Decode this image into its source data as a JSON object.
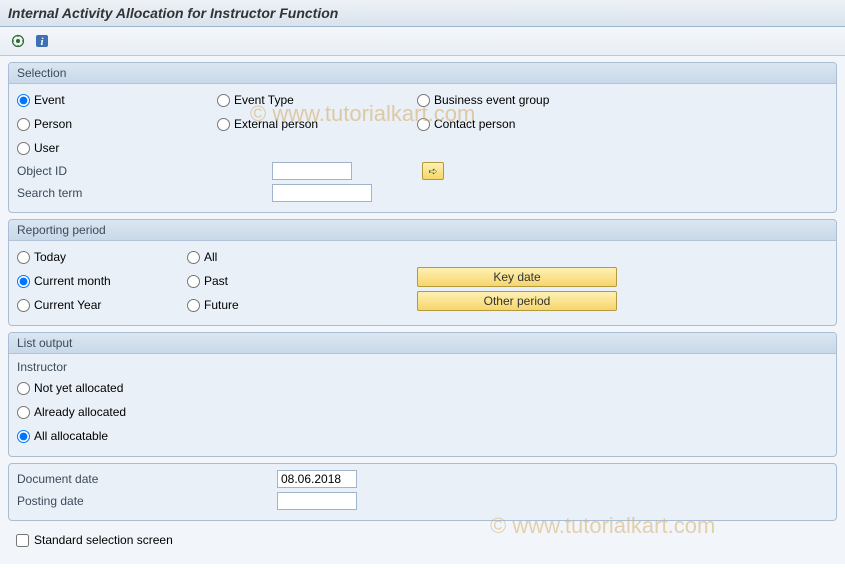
{
  "title": "Internal Activity Allocation for Instructor Function",
  "watermark": "© www.tutorialkart.com",
  "toolbar": {
    "execute_icon": "execute",
    "info_icon": "info"
  },
  "selection": {
    "header": "Selection",
    "options": {
      "event": "Event",
      "event_type": "Event Type",
      "business_event_group": "Business event group",
      "person": "Person",
      "external_person": "External person",
      "contact_person": "Contact person",
      "user": "User"
    },
    "fields": {
      "object_id_label": "Object ID",
      "object_id_value": "",
      "search_term_label": "Search term",
      "search_term_value": ""
    },
    "arrow_label": "➪"
  },
  "reporting": {
    "header": "Reporting period",
    "options": {
      "today": "Today",
      "all": "All",
      "current_month": "Current month",
      "past": "Past",
      "current_year": "Current Year",
      "future": "Future"
    },
    "buttons": {
      "key_date": "Key date",
      "other_period": "Other period"
    }
  },
  "list_output": {
    "header": "List output",
    "sub_label": "Instructor",
    "options": {
      "not_yet": "Not yet allocated",
      "already": "Already allocated",
      "all": "All allocatable"
    }
  },
  "dates": {
    "document_date_label": "Document date",
    "document_date_value": "08.06.2018",
    "posting_date_label": "Posting date",
    "posting_date_value": ""
  },
  "checkbox": {
    "standard_selection": "Standard selection screen"
  }
}
